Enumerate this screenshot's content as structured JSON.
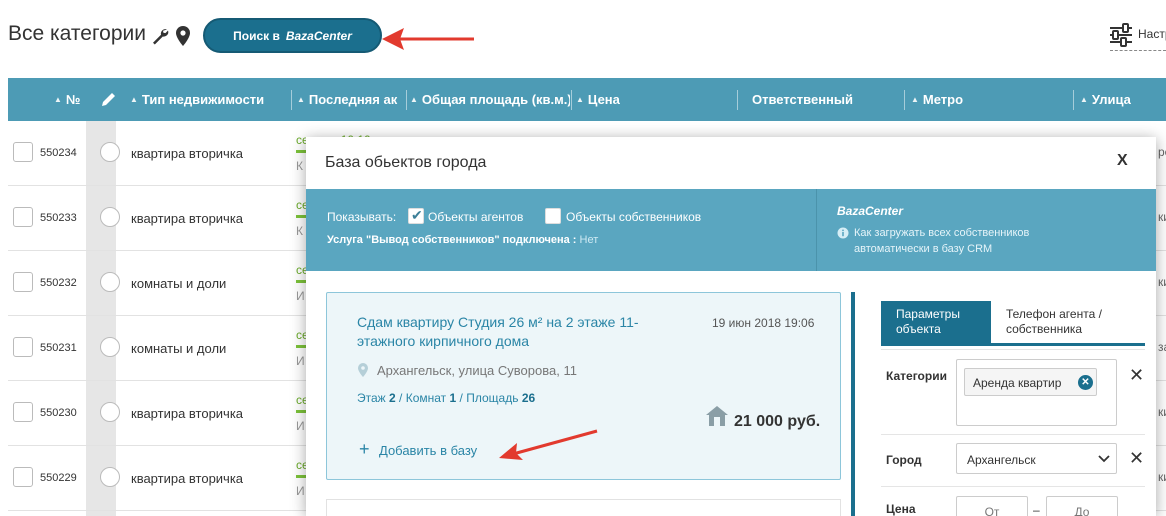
{
  "header": {
    "title": "Все категории",
    "search_button": {
      "prefix": "Поиск в",
      "brand": "BazaCenter"
    },
    "settings_label": "Настр"
  },
  "table": {
    "columns": [
      "№",
      "Тип недвижимости",
      "Последняя ак",
      "Общая площадь (кв.м.)",
      "Цена",
      "Ответственный",
      "Метро",
      "Улица"
    ],
    "rows": [
      {
        "id": "550234",
        "type": "квартира вторичка",
        "status": "се",
        "status_extra": "10.10",
        "sub": "К",
        "right": "ре"
      },
      {
        "id": "550233",
        "type": "квартира вторичка",
        "status": "се",
        "sub": "К",
        "right": "ки"
      },
      {
        "id": "550232",
        "type": "комнаты и доли",
        "status": "се",
        "sub": "И",
        "right": "ки"
      },
      {
        "id": "550231",
        "type": "комнаты и доли",
        "status": "се",
        "sub": "И",
        "right": "за"
      },
      {
        "id": "550230",
        "type": "квартира вторичка",
        "status": "се",
        "sub": "И",
        "right": "ки"
      },
      {
        "id": "550229",
        "type": "квартира вторичка",
        "status": "се",
        "sub": "И",
        "right": "ки"
      }
    ]
  },
  "modal": {
    "title": "База обьектов города",
    "close": "X",
    "filters": {
      "show_label": "Показывать:",
      "agents_label": "Объекты агентов",
      "agents_checked": true,
      "owners_label": "Объекты собственников",
      "owners_checked": false,
      "service_label": "Услуга \"Вывод собственников\" подключена :",
      "service_value": "Нет"
    },
    "bazacenter": {
      "brand": "BazaCenter",
      "info_text": "Как загружать всех собственников автоматически в базу CRM"
    },
    "listing": {
      "title": "Сдам квартиру Студия 26 м² на 2 этаже 11-этажного кирпичного дома",
      "date": "19 июн 2018  19:06",
      "address": "Архангельск, улица Суворова, 11",
      "floor_label": "Этаж",
      "floor": "2",
      "rooms_label": "Комнат",
      "rooms": "1",
      "area_label": "Площадь",
      "area": "26",
      "sep": " / ",
      "price": "21 000 руб.",
      "add_label": "Добавить в базу"
    },
    "params": {
      "tab_active": "Параметры объекта",
      "tab_inactive": "Телефон агента / собственника",
      "category_label": "Категории",
      "category_tag": "Аренда квартир",
      "city_label": "Город",
      "city_value": "Архангельск",
      "price_label": "Цена",
      "price_from_placeholder": "От",
      "price_dash": "–",
      "price_to_placeholder": "До"
    }
  },
  "colors": {
    "primary": "#1b6f8e",
    "header_teal": "#4d9bb5",
    "filter_teal": "#5aa6c0",
    "status_green": "#7cc23a",
    "arrow_red": "#e23a2e"
  }
}
